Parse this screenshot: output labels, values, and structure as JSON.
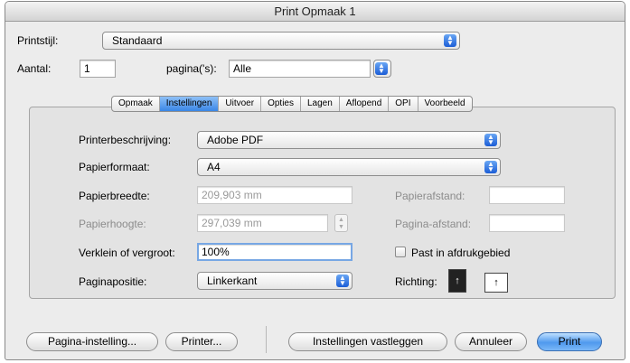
{
  "window": {
    "title": "Print Opmaak 1"
  },
  "top": {
    "printstijl_label": "Printstijl:",
    "printstijl_value": "Standaard",
    "aantal_label": "Aantal:",
    "aantal_value": "1",
    "paginas_label": "pagina('s):",
    "paginas_value": "Alle"
  },
  "tabs": [
    {
      "label": "Opmaak"
    },
    {
      "label": "Instellingen",
      "active": true
    },
    {
      "label": "Uitvoer"
    },
    {
      "label": "Opties"
    },
    {
      "label": "Lagen"
    },
    {
      "label": "Aflopend"
    },
    {
      "label": "OPI"
    },
    {
      "label": "Voorbeeld"
    }
  ],
  "settings": {
    "printer_label": "Printerbeschrijving:",
    "printer_value": "Adobe PDF",
    "papierformaat_label": "Papierformaat:",
    "papierformaat_value": "A4",
    "papierbreedte_label": "Papierbreedte:",
    "papierbreedte_value": "209,903 mm",
    "papierhoogte_label": "Papierhoogte:",
    "papierhoogte_value": "297,039 mm",
    "papierafstand_label": "Papierafstand:",
    "papierafstand_value": "",
    "pagina_afstand_label": "Pagina-afstand:",
    "pagina_afstand_value": "",
    "verklein_label": "Verklein of vergroot:",
    "verklein_value": "100%",
    "past_label": "Past in afdrukgebied",
    "paginapositie_label": "Paginapositie:",
    "paginapositie_value": "Linkerkant",
    "richting_label": "Richting:"
  },
  "buttons": {
    "pagina_instelling": "Pagina-instelling...",
    "printer": "Printer...",
    "vastleggen": "Instellingen vastleggen",
    "annuleer": "Annuleer",
    "print": "Print"
  },
  "icons": {
    "popup_arrows": "up-down-arrows-icon",
    "portrait": "portrait-orientation-icon",
    "landscape": "landscape-orientation-icon",
    "stepper": "stepper-icon"
  },
  "colors": {
    "accent": "#3a86e6",
    "default_button": "#4f99ee"
  }
}
